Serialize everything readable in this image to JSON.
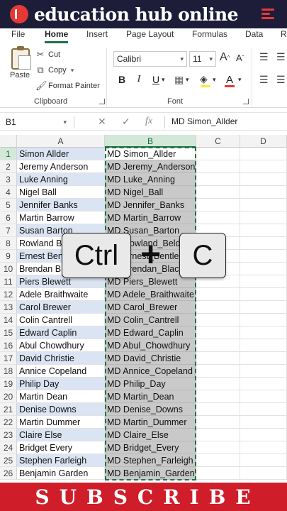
{
  "brand": {
    "title": "education hub online"
  },
  "tabs": [
    "File",
    "Home",
    "Insert",
    "Page Layout",
    "Formulas",
    "Data",
    "R"
  ],
  "active_tab": "Home",
  "clipboard": {
    "paste": "Paste",
    "cut": "Cut",
    "copy": "Copy",
    "format_painter": "Format Painter",
    "label": "Clipboard"
  },
  "font": {
    "name": "Calibri",
    "size": "11",
    "grow": "A",
    "shrink": "A",
    "bold": "B",
    "italic": "I",
    "underline": "U",
    "font_color": "A",
    "label": "Font",
    "fill_color": "#ffeb3b",
    "text_color": "#e53935"
  },
  "formula_bar": {
    "name_box": "B1",
    "fx": "fx",
    "content": "MD Simon_Allder"
  },
  "columns": [
    "A",
    "B",
    "C",
    "D"
  ],
  "rows": [
    {
      "n": "1",
      "a": "Simon Allder",
      "b": "MD Simon_Allder"
    },
    {
      "n": "2",
      "a": "Jeremy Anderson",
      "b": "MD Jeremy_Anderson"
    },
    {
      "n": "3",
      "a": "Luke Anning",
      "b": "MD Luke_Anning"
    },
    {
      "n": "4",
      "a": "Nigel Ball",
      "b": "MD Nigel_Ball"
    },
    {
      "n": "5",
      "a": "Jennifer Banks",
      "b": "MD Jennifer_Banks"
    },
    {
      "n": "6",
      "a": "Martin Barrow",
      "b": "MD Martin_Barrow"
    },
    {
      "n": "7",
      "a": "Susan Barton",
      "b": "MD Susan_Barton"
    },
    {
      "n": "8",
      "a": "Rowland B",
      "b": "MD Rowland_Beld"
    },
    {
      "n": "9",
      "a": "Ernest Ben",
      "b": "MD Ernest_Bentle"
    },
    {
      "n": "10",
      "a": "Brendan B",
      "b": "MD Brendan_Black"
    },
    {
      "n": "11",
      "a": "Piers Blewett",
      "b": "MD Piers_Blewett"
    },
    {
      "n": "12",
      "a": "Adele Braithwaite",
      "b": "MD Adele_Braithwaite"
    },
    {
      "n": "13",
      "a": "Carol Brewer",
      "b": "MD Carol_Brewer"
    },
    {
      "n": "14",
      "a": "Colin Cantrell",
      "b": "MD Colin_Cantrell"
    },
    {
      "n": "15",
      "a": "Edward Caplin",
      "b": "MD Edward_Caplin"
    },
    {
      "n": "16",
      "a": "Abul Chowdhury",
      "b": "MD Abul_Chowdhury"
    },
    {
      "n": "17",
      "a": "David Christie",
      "b": "MD David_Christie"
    },
    {
      "n": "18",
      "a": "Annice Copeland",
      "b": "MD Annice_Copeland"
    },
    {
      "n": "19",
      "a": "Philip Day",
      "b": "MD Philip_Day"
    },
    {
      "n": "20",
      "a": "Martin Dean",
      "b": "MD Martin_Dean"
    },
    {
      "n": "21",
      "a": "Denise Downs",
      "b": "MD Denise_Downs"
    },
    {
      "n": "22",
      "a": "Martin Dummer",
      "b": "MD Martin_Dummer"
    },
    {
      "n": "23",
      "a": "Claire Else",
      "b": "MD Claire_Else"
    },
    {
      "n": "24",
      "a": "Bridget Every",
      "b": "MD Bridget_Every"
    },
    {
      "n": "25",
      "a": "Stephen Farleigh",
      "b": "MD Stephen_Farleigh"
    },
    {
      "n": "26",
      "a": "Benjamin Garden",
      "b": "MD Benjamin_Garden"
    }
  ],
  "overlay": {
    "key1": "Ctrl",
    "plus": "+",
    "key2": "C"
  },
  "banner": {
    "text": "SUBSCRIBE"
  },
  "colors": {
    "accent": "#1e7145",
    "brand_bg": "#1d1d3a",
    "banner": "#cf1e2a"
  }
}
